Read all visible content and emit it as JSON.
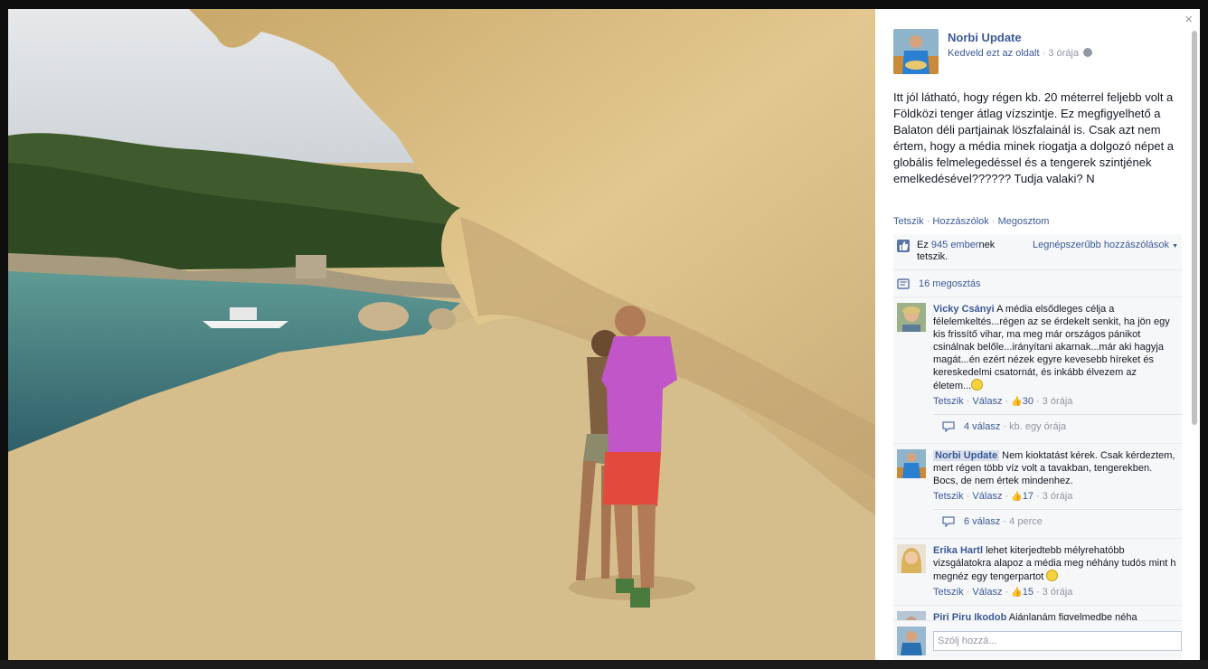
{
  "close_label": "×",
  "post": {
    "page_name": "Norbi Update",
    "like_page_link": "Kedveld ezt az oldalt",
    "separator": "·",
    "time": "3 órája",
    "text": "Itt jól látható, hogy régen kb. 20 méterrel feljebb volt a Földközi tenger átlag vízszintje. Ez megfigyelhető a Balaton déli partjainak löszfalainál is. Csak azt nem értem, hogy a média minek riogatja a dolgozó népet a globális felmelegedéssel és a tengerek szintjének emelkedésével?????? Tudja valaki? N",
    "actions": {
      "like": "Tetszik",
      "comment": "Hozzászólok",
      "share": "Megosztom",
      "dot": "·"
    }
  },
  "ufi": {
    "likes_prefix": "Ez ",
    "likes_count": "945 ember",
    "likes_suffix": "nek tetszik.",
    "sort_label": "Legnépszerűbb hozzászólások",
    "shares": "16 megosztás"
  },
  "comments": [
    {
      "author": "Vicky Csányi",
      "text": "A média elsődleges célja a félelemkeltés...régen az se érdekelt senkit, ha jön egy kis frissítő vihar, ma meg már országos pánikot csinálnak belőle...irányítani akarnak...már aki hagyja magát...én ezért nézek egyre kevesebb híreket és kereskedelmi csatornát, és inkább élvezem az életem...",
      "like": "Tetszik",
      "reply": "Válasz",
      "likes": "30",
      "time": "3 órája",
      "replies_count": "4 válasz",
      "replies_time": "kb. egy órája"
    },
    {
      "author": "Norbi Update",
      "text": "Nem kioktatást kérek. Csak kérdeztem, mert régen több víz volt a tavakban, tengerekben. Bocs, de nem értek mindenhez.",
      "like": "Tetszik",
      "reply": "Válasz",
      "likes": "17",
      "time": "3 órája",
      "replies_count": "6 válasz",
      "replies_time": "4 perce"
    },
    {
      "author": "Erika Hartl",
      "text": "lehet kiterjedtebb mélyrehatóbb vizsgálatokra alapoz a média meg néhány tudós mint h megnéz egy tengerpartot",
      "like": "Tetszik",
      "reply": "Válasz",
      "likes": "15",
      "time": "3 órája"
    },
    {
      "author": "Piri Piru Ikodob",
      "text": "Ajánlanám figyelmedbe néha"
    }
  ],
  "composer": {
    "placeholder": "Szólj hozzá..."
  },
  "icons": {
    "close": "close-icon",
    "globe": "globe-icon",
    "like": "thumbs-up-icon",
    "share": "share-icon",
    "reply": "reply-bubble-icon",
    "smile": "smiley-icon"
  },
  "colors": {
    "link": "#3b5998",
    "muted": "#9197a3",
    "ufi_bg": "#f6f7f8"
  }
}
